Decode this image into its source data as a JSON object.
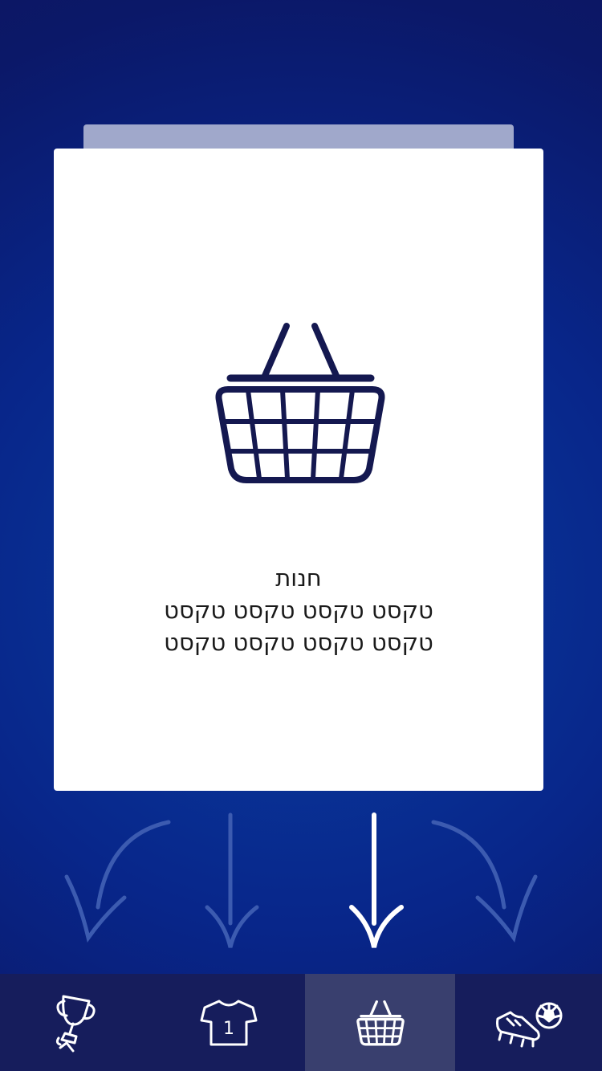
{
  "card": {
    "title": "חנות",
    "line1": "טקסט טקסט טקסט טקסט",
    "line2": "טקסט טקסט טקסט טקסט",
    "icon": "shopping-basket-icon"
  },
  "tabbar": {
    "active_index": 2,
    "items": [
      {
        "icon": "trophy-icon"
      },
      {
        "icon": "jersey-icon",
        "label": "1"
      },
      {
        "icon": "shopping-basket-icon"
      },
      {
        "icon": "football-boot-icon"
      }
    ]
  },
  "colors": {
    "background": "#08268a",
    "card": "#ffffff",
    "icon_dark": "#141850",
    "tabbar": "#161d5c",
    "tab_active": "#393f6e"
  }
}
